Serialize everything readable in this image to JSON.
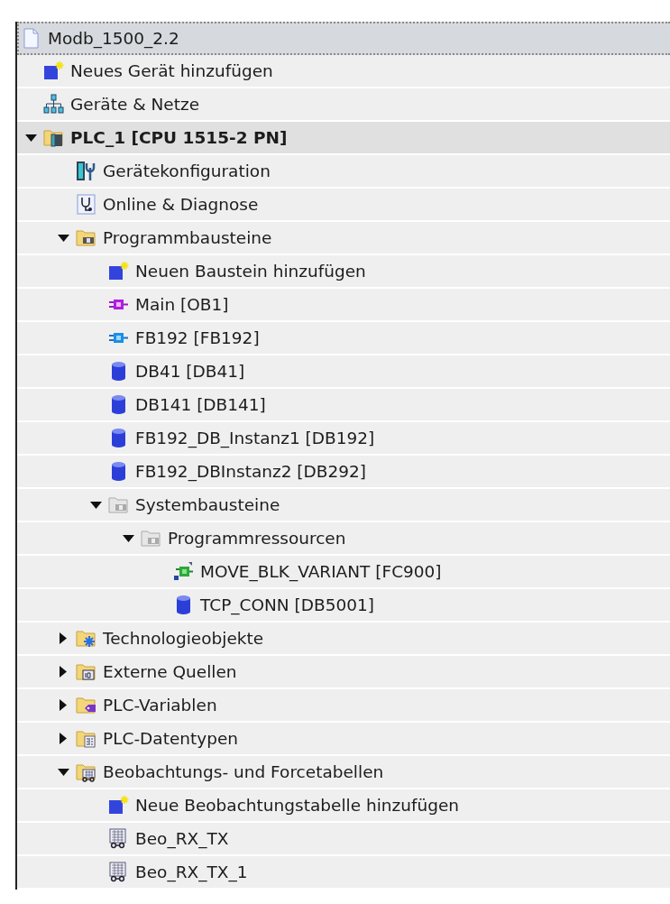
{
  "project_tree": {
    "items": [
      {
        "label": "Modb_1500_2.2",
        "kind": "project",
        "selected": true,
        "children": [
          {
            "label": "Neues Gerät hinzufügen",
            "kind": "add",
            "selected": false
          },
          {
            "label": "Geräte & Netze",
            "kind": "network",
            "selected": false
          },
          {
            "label": "PLC_1 [CPU 1515-2 PN]",
            "kind": "plc",
            "selected": false,
            "expanded": true,
            "children": [
              {
                "label": "Gerätekonfiguration",
                "kind": "config",
                "selected": false
              },
              {
                "label": "Online & Diagnose",
                "kind": "diagnose",
                "selected": false
              },
              {
                "label": "Programmbausteine",
                "kind": "blocks-folder",
                "selected": false,
                "expanded": true,
                "children": [
                  {
                    "label": "Neuen Baustein hinzufügen",
                    "kind": "add",
                    "selected": false
                  },
                  {
                    "label": "Main [OB1]",
                    "kind": "ob",
                    "selected": false
                  },
                  {
                    "label": "FB192 [FB192]",
                    "kind": "fb",
                    "selected": false
                  },
                  {
                    "label": "DB41 [DB41]",
                    "kind": "db",
                    "selected": false
                  },
                  {
                    "label": "DB141 [DB141]",
                    "kind": "db",
                    "selected": false
                  },
                  {
                    "label": "FB192_DB_Instanz1 [DB192]",
                    "kind": "db",
                    "selected": false
                  },
                  {
                    "label": "FB192_DBInstanz2 [DB292]",
                    "kind": "db",
                    "selected": false
                  },
                  {
                    "label": "Systembausteine",
                    "kind": "system-folder",
                    "selected": false,
                    "expanded": true,
                    "children": [
                      {
                        "label": "Programmressourcen",
                        "kind": "system-folder",
                        "selected": false,
                        "expanded": true,
                        "children": [
                          {
                            "label": "MOVE_BLK_VARIANT [FC900]",
                            "kind": "fc",
                            "selected": false
                          },
                          {
                            "label": "TCP_CONN [DB5001]",
                            "kind": "db",
                            "selected": false
                          }
                        ]
                      }
                    ]
                  }
                ]
              },
              {
                "label": "Technologieobjekte",
                "kind": "tech-folder",
                "selected": false,
                "expanded": false
              },
              {
                "label": "Externe Quellen",
                "kind": "sources-folder",
                "selected": false,
                "expanded": false
              },
              {
                "label": "PLC-Variablen",
                "kind": "tags-folder",
                "selected": false,
                "expanded": false
              },
              {
                "label": "PLC-Datentypen",
                "kind": "types-folder",
                "selected": false,
                "expanded": false
              },
              {
                "label": "Beobachtungs- und Forcetabellen",
                "kind": "watch-folder",
                "selected": false,
                "expanded": true,
                "children": [
                  {
                    "label": "Neue Beobachtungstabelle hinzufügen",
                    "kind": "add",
                    "selected": false
                  },
                  {
                    "label": "Beo_RX_TX",
                    "kind": "watch-table",
                    "selected": false
                  },
                  {
                    "label": "Beo_RX_TX_1",
                    "kind": "watch-table",
                    "selected": false
                  }
                ]
              }
            ]
          }
        ]
      }
    ]
  }
}
